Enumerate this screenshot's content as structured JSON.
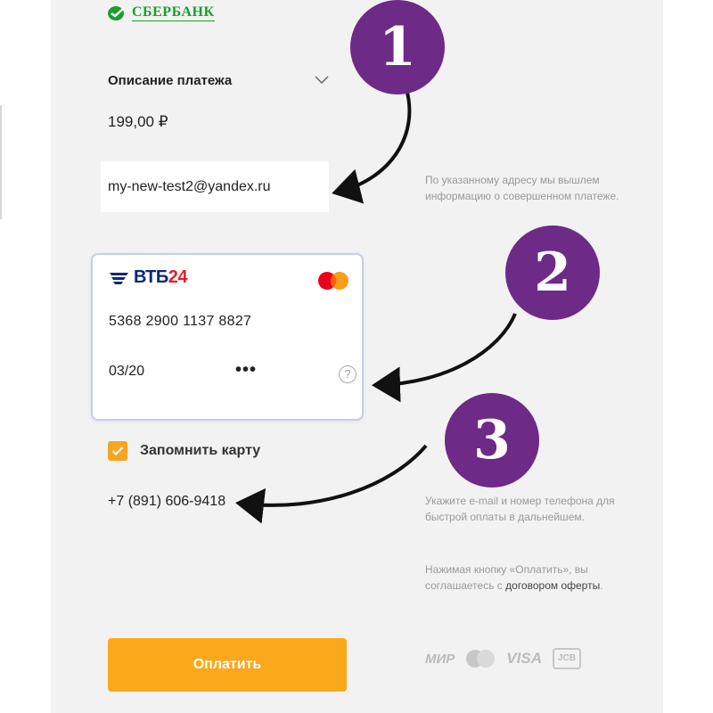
{
  "logo": {
    "text": "СБЕРБАНК",
    "color": "#1a9f29"
  },
  "payment": {
    "description_label": "Описание платежа",
    "amount": "199,00 ₽"
  },
  "email": {
    "value": "my-new-test2@yandex.ru",
    "hint": "По указанному адресу мы вышлем информацию о совершенном платеже."
  },
  "card": {
    "bank_name_prefix": "ВТБ",
    "bank_name_number": "24",
    "number": "5368 2900 1137 8827",
    "expiry": "03/20",
    "cvc_mask": "•••",
    "help_symbol": "?"
  },
  "remember": {
    "label": "Запомнить карту",
    "checked": true
  },
  "phone": {
    "value": "+7 (891) 606-9418",
    "hint": "Укажите e-mail и номер телефона для быстрой оплаты в дальнейшем."
  },
  "agreement": {
    "text": "Нажимая кнопку «Оплатить», вы соглашаетесь с ",
    "link": "договором оферты",
    "suffix": "."
  },
  "pay_button": {
    "label": "Оплатить",
    "color": "#fba81b"
  },
  "payment_systems": {
    "mir": "МИР",
    "visa": "VISA",
    "jcb": "JCB"
  },
  "badges": [
    "1",
    "2",
    "3"
  ],
  "colors": {
    "badge": "#6d2a87",
    "checkbox": "#f6a623"
  }
}
